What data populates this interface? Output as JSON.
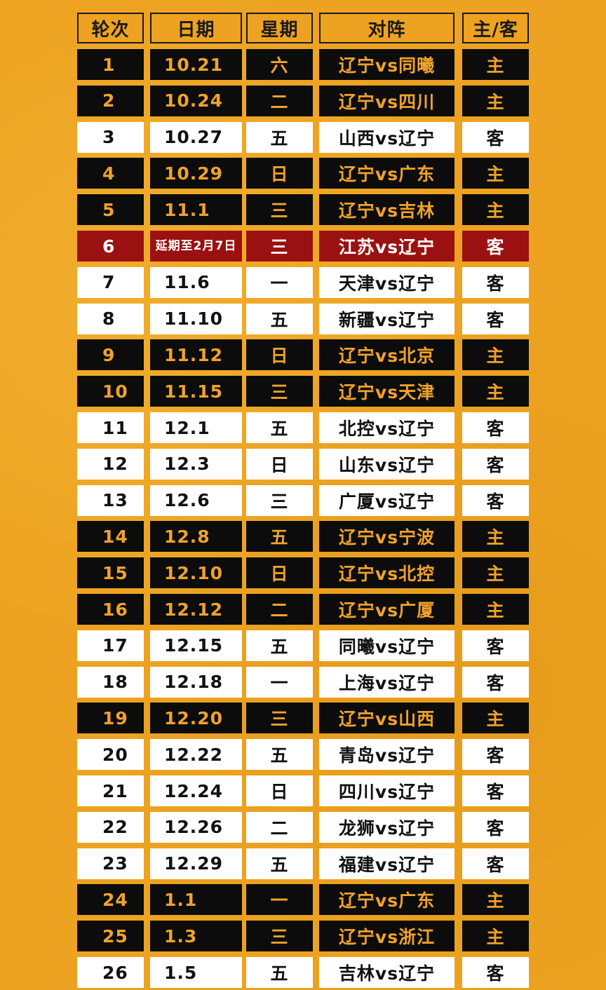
{
  "headers": [
    "轮次",
    "日期",
    "星期",
    "对阵",
    "主/客"
  ],
  "colors": {
    "home_bg": "#0c0c0c",
    "home_text": "#f0a22a",
    "away_bg": "#ffffff",
    "away_text": "#111111",
    "postponed_bg": "#9b1111",
    "page_bg": "#eda321"
  },
  "rows": [
    {
      "round": "1",
      "date": "10.21",
      "weekday": "六",
      "match": "辽宁vs同曦",
      "side": "主",
      "style": "home"
    },
    {
      "round": "2",
      "date": "10.24",
      "weekday": "二",
      "match": "辽宁vs四川",
      "side": "主",
      "style": "home"
    },
    {
      "round": "3",
      "date": "10.27",
      "weekday": "五",
      "match": "山西vs辽宁",
      "side": "客",
      "style": "away"
    },
    {
      "round": "4",
      "date": "10.29",
      "weekday": "日",
      "match": "辽宁vs广东",
      "side": "主",
      "style": "home"
    },
    {
      "round": "5",
      "date": "11.1",
      "weekday": "三",
      "match": "辽宁vs吉林",
      "side": "主",
      "style": "home"
    },
    {
      "round": "6",
      "date": "延期至2月7日",
      "weekday": "三",
      "match": "江苏vs辽宁",
      "side": "客",
      "style": "postponed"
    },
    {
      "round": "7",
      "date": "11.6",
      "weekday": "一",
      "match": "天津vs辽宁",
      "side": "客",
      "style": "away"
    },
    {
      "round": "8",
      "date": "11.10",
      "weekday": "五",
      "match": "新疆vs辽宁",
      "side": "客",
      "style": "away"
    },
    {
      "round": "9",
      "date": "11.12",
      "weekday": "日",
      "match": "辽宁vs北京",
      "side": "主",
      "style": "home"
    },
    {
      "round": "10",
      "date": "11.15",
      "weekday": "三",
      "match": "辽宁vs天津",
      "side": "主",
      "style": "home"
    },
    {
      "round": "11",
      "date": "12.1",
      "weekday": "五",
      "match": "北控vs辽宁",
      "side": "客",
      "style": "away"
    },
    {
      "round": "12",
      "date": "12.3",
      "weekday": "日",
      "match": "山东vs辽宁",
      "side": "客",
      "style": "away"
    },
    {
      "round": "13",
      "date": "12.6",
      "weekday": "三",
      "match": "广厦vs辽宁",
      "side": "客",
      "style": "away"
    },
    {
      "round": "14",
      "date": "12.8",
      "weekday": "五",
      "match": "辽宁vs宁波",
      "side": "主",
      "style": "home"
    },
    {
      "round": "15",
      "date": "12.10",
      "weekday": "日",
      "match": "辽宁vs北控",
      "side": "主",
      "style": "home"
    },
    {
      "round": "16",
      "date": "12.12",
      "weekday": "二",
      "match": "辽宁vs广厦",
      "side": "主",
      "style": "home"
    },
    {
      "round": "17",
      "date": "12.15",
      "weekday": "五",
      "match": "同曦vs辽宁",
      "side": "客",
      "style": "away"
    },
    {
      "round": "18",
      "date": "12.18",
      "weekday": "一",
      "match": "上海vs辽宁",
      "side": "客",
      "style": "away"
    },
    {
      "round": "19",
      "date": "12.20",
      "weekday": "三",
      "match": "辽宁vs山西",
      "side": "主",
      "style": "home"
    },
    {
      "round": "20",
      "date": "12.22",
      "weekday": "五",
      "match": "青岛vs辽宁",
      "side": "客",
      "style": "away"
    },
    {
      "round": "21",
      "date": "12.24",
      "weekday": "日",
      "match": "四川vs辽宁",
      "side": "客",
      "style": "away"
    },
    {
      "round": "22",
      "date": "12.26",
      "weekday": "二",
      "match": "龙狮vs辽宁",
      "side": "客",
      "style": "away"
    },
    {
      "round": "23",
      "date": "12.29",
      "weekday": "五",
      "match": "福建vs辽宁",
      "side": "客",
      "style": "away"
    },
    {
      "round": "24",
      "date": "1.1",
      "weekday": "一",
      "match": "辽宁vs广东",
      "side": "主",
      "style": "home"
    },
    {
      "round": "25",
      "date": "1.3",
      "weekday": "三",
      "match": "辽宁vs浙江",
      "side": "主",
      "style": "home"
    },
    {
      "round": "26",
      "date": "1.5",
      "weekday": "五",
      "match": "吉林vs辽宁",
      "side": "客",
      "style": "away"
    }
  ]
}
